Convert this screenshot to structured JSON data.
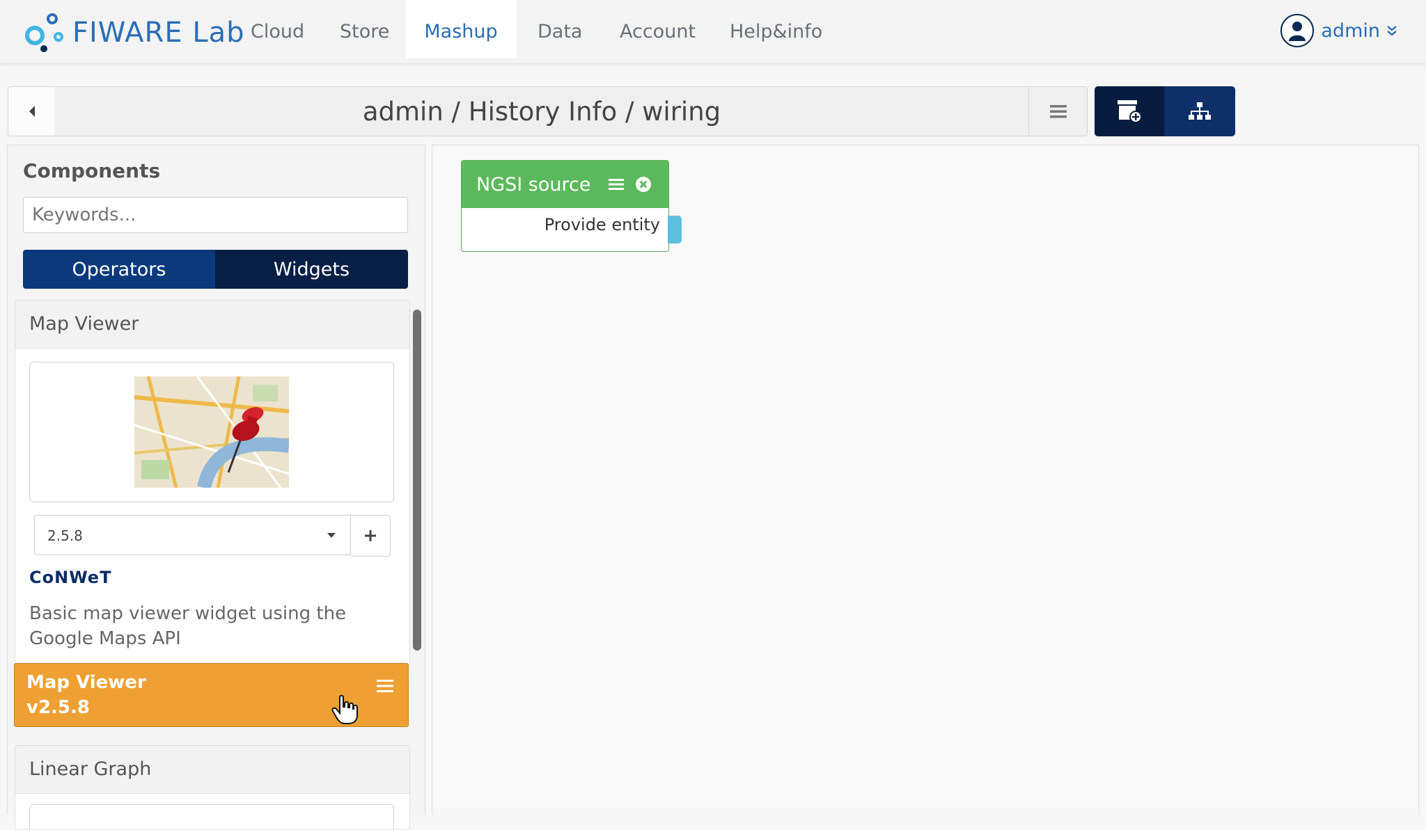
{
  "brand": {
    "name": "FIWARE Lab"
  },
  "nav": {
    "items": [
      {
        "label": "Cloud"
      },
      {
        "label": "Store"
      },
      {
        "label": "Mashup"
      },
      {
        "label": "Data"
      },
      {
        "label": "Account"
      },
      {
        "label": "Help&info"
      }
    ],
    "active": "Mashup"
  },
  "user": {
    "name": "admin"
  },
  "breadcrumb": {
    "text": "admin / History Info / wiring"
  },
  "components": {
    "title": "Components",
    "search_placeholder": "Keywords...",
    "tabs": {
      "operators": "Operators",
      "widgets": "Widgets"
    },
    "items": [
      {
        "name": "Map Viewer",
        "version": "2.5.8",
        "vendor": "CoNWeT",
        "description": "Basic map viewer widget using the Google Maps API"
      },
      {
        "name": "Linear Graph"
      }
    ]
  },
  "drag_chip": {
    "line1": "Map Viewer",
    "line2": "v2.5.8"
  },
  "wiring": {
    "operator": {
      "title": "NGSI source",
      "endpoint": "Provide entity"
    }
  },
  "colors": {
    "brand": "#2a6eb5",
    "operator_green": "#5cb85c",
    "drag_orange": "#eea033",
    "endpoint_blue": "#5bc0de",
    "dark_navy": "#071f45"
  }
}
